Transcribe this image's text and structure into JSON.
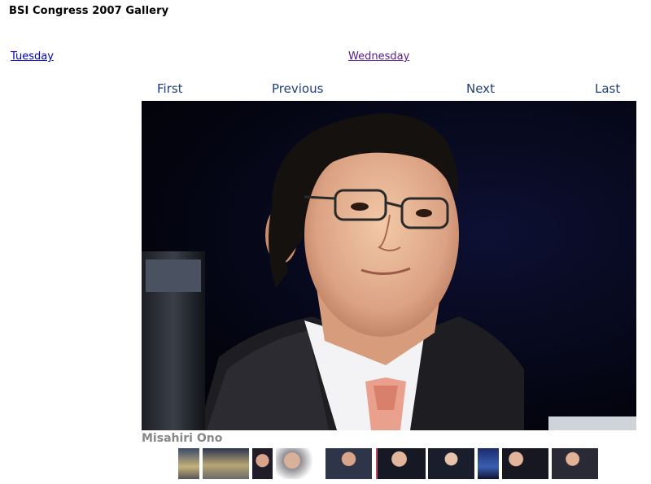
{
  "header": {
    "title": "BSI Congress 2007 Gallery"
  },
  "days": {
    "prev_day": "Tuesday",
    "next_day": "Wednesday"
  },
  "pager": {
    "first": "First",
    "previous": "Previous",
    "next": "Next",
    "last": "Last"
  },
  "photo": {
    "caption": "Misahiri Ono"
  },
  "colors": {
    "link": "#0000cc",
    "visited_link": "#551a8b",
    "pager": "#1f3f7a",
    "caption": "#888888"
  }
}
